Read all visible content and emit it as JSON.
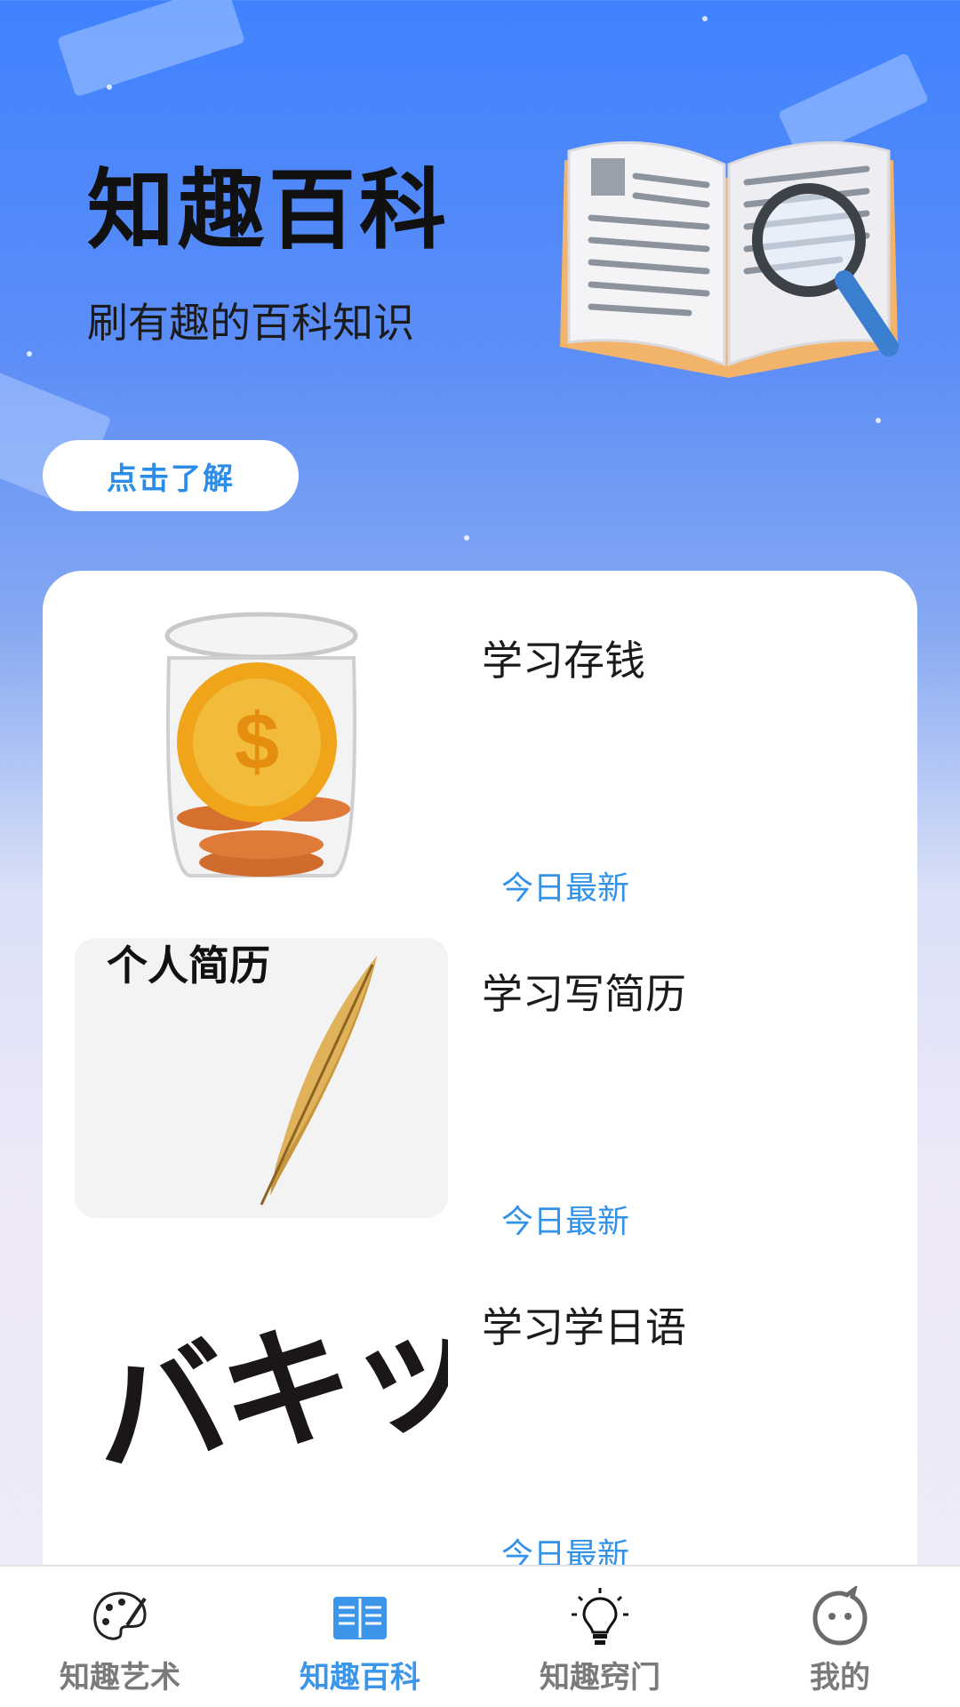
{
  "hero": {
    "title": "知趣百科",
    "subtitle": "刷有趣的百科知识",
    "button_label": "点击了解"
  },
  "list": {
    "items": [
      {
        "title": "学习存钱",
        "tag": "今日最新",
        "image": "coin-jar-icon"
      },
      {
        "title": "学习写简历",
        "tag": "今日最新",
        "image": "quill-pen-icon",
        "image_caption": "个人简历"
      },
      {
        "title": "学习学日语",
        "tag": "今日最新",
        "image": "japanese-text-art",
        "image_caption": "バキッ"
      }
    ]
  },
  "bottom_nav": {
    "items": [
      {
        "label": "知趣艺术",
        "icon": "palette-icon",
        "active": false
      },
      {
        "label": "知趣百科",
        "icon": "book-icon",
        "active": true
      },
      {
        "label": "知趣窍门",
        "icon": "lightbulb-icon",
        "active": false
      },
      {
        "label": "我的",
        "icon": "profile-face-icon",
        "active": false
      }
    ]
  },
  "colors": {
    "accent": "#3b96ea",
    "tag": "#3292e8",
    "inactive_nav": "#7a7a7a",
    "background_top": "#3f82ff"
  }
}
